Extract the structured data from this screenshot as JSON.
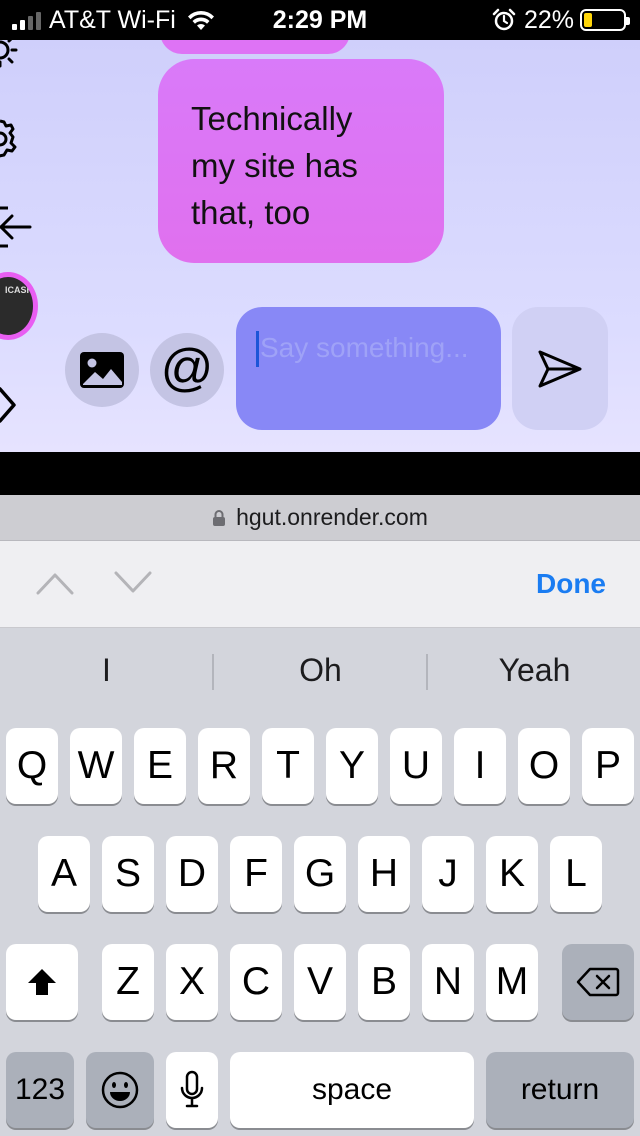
{
  "status_bar": {
    "carrier": "AT&T Wi-Fi",
    "time": "2:29 PM",
    "battery": "22%",
    "battery_level": 0.22,
    "icons": [
      "signal-icon",
      "wifi-icon",
      "alarm-icon",
      "battery-icon"
    ]
  },
  "chat": {
    "message": "Technically\nmy site has\nthat, too",
    "input_placeholder": "Say something...",
    "sidebar_icons": [
      "sun-icon",
      "gear-icon",
      "logout-icon",
      "avatar",
      "chevron-right-icon"
    ],
    "avatar_text": "ICASH",
    "mention_symbol": "@",
    "colors": {
      "bubble": "#de73f5",
      "input": "#8888f6",
      "background": "#d8d8fd"
    }
  },
  "browser": {
    "url": "hgut.onrender.com"
  },
  "accessory": {
    "done_label": "Done"
  },
  "keyboard": {
    "suggestions": [
      "I",
      "Oh",
      "Yeah"
    ],
    "row1": [
      "Q",
      "W",
      "E",
      "R",
      "T",
      "Y",
      "U",
      "I",
      "O",
      "P"
    ],
    "row2": [
      "A",
      "S",
      "D",
      "F",
      "G",
      "H",
      "J",
      "K",
      "L"
    ],
    "row3": [
      "Z",
      "X",
      "C",
      "V",
      "B",
      "N",
      "M"
    ],
    "numbers_label": "123",
    "space_label": "space",
    "return_label": "return"
  }
}
